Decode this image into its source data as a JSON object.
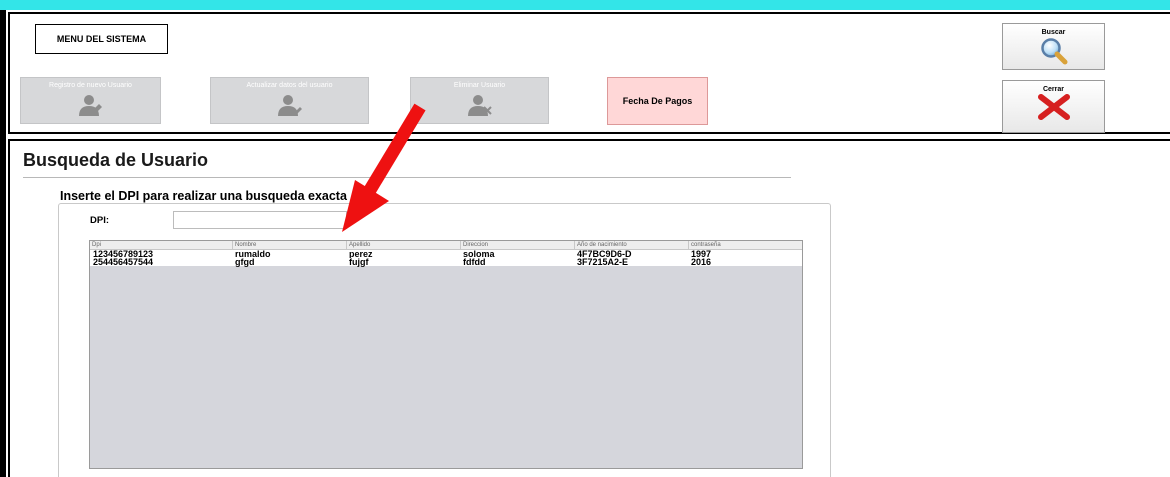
{
  "menu": {
    "title": "MENU DEL SISTEMA"
  },
  "toolbar": {
    "registro_label": "Registro de nuevo Usuario",
    "actualizar_label": "Actualizar datos del usuario",
    "eliminar_label": "Eliminar Usuario",
    "pagos_label": "Fecha De Pagos",
    "buscar_label": "Buscar",
    "cerrar_label": "Cerrar",
    "user_icon": "user-icon",
    "search_icon": "magnifier-icon",
    "close_icon": "red-x-icon"
  },
  "main": {
    "title": "Busqueda de Usuario",
    "subtitle": "Inserte el DPI para realizar una busqueda exacta",
    "dpi_label": "DPI:",
    "dpi_value": ""
  },
  "table": {
    "headers": [
      "Dpi",
      "Nombre",
      "Apellido",
      "Direccion",
      "Año de nacimiento",
      "contraseña"
    ],
    "rows": [
      [
        "123456789123",
        "rumaldo",
        "perez",
        "soloma",
        "4F7BC9D6-D",
        "1997"
      ],
      [
        "254456457544",
        "gfgd",
        "fujgf",
        "fdfdd",
        "3F7215A2-E",
        "2016"
      ]
    ]
  },
  "colors": {
    "top_bar": "#33e5e8",
    "table_bg": "#d5d6dc",
    "pagos_bg": "#ffd7d7",
    "arrow": "#ee1111"
  }
}
